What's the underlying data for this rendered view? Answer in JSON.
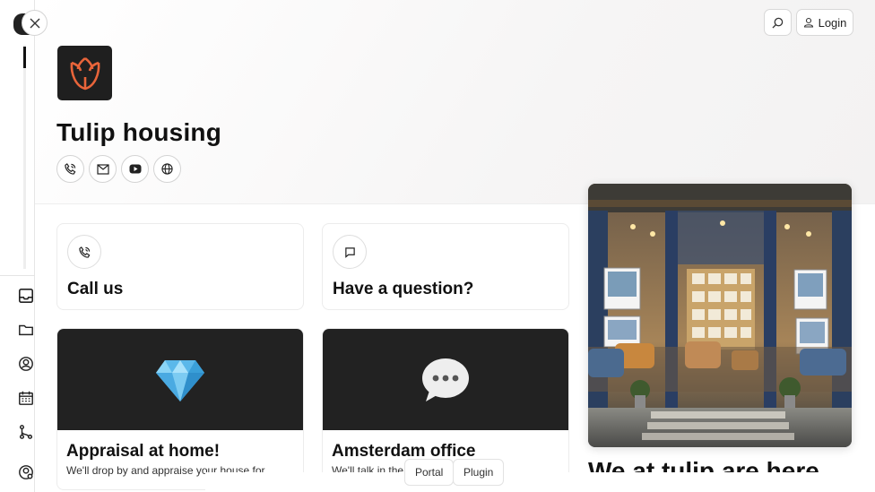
{
  "header": {
    "login_label": "Login"
  },
  "brand": {
    "name": "Tulip housing"
  },
  "cards": {
    "call": {
      "title": "Call us"
    },
    "question": {
      "title": "Have a question?"
    }
  },
  "features": [
    {
      "title": "Appraisal at home!",
      "text": "We'll drop by and appraise your house for"
    },
    {
      "title": "Amsterdam office",
      "text": "We'll talk in the"
    }
  ],
  "chips": [
    "Portal",
    "Plugin"
  ],
  "photo_caption": "We at tulip are here",
  "icons": {
    "close": "close-icon",
    "search": "search-icon",
    "user": "user-icon",
    "phone": "phone-icon",
    "mail": "mail-icon",
    "youtube": "youtube-icon",
    "globe": "globe-icon",
    "chat": "chat-icon",
    "diamond": "gem-icon",
    "speech": "speech-bubble-icon",
    "rail": [
      "inbox-icon",
      "folder-icon",
      "user-circle-icon",
      "calendar-icon",
      "flow-icon",
      "settings-user-icon"
    ]
  },
  "colors": {
    "accent": "#e8643a",
    "dark": "#1f1f1f"
  }
}
